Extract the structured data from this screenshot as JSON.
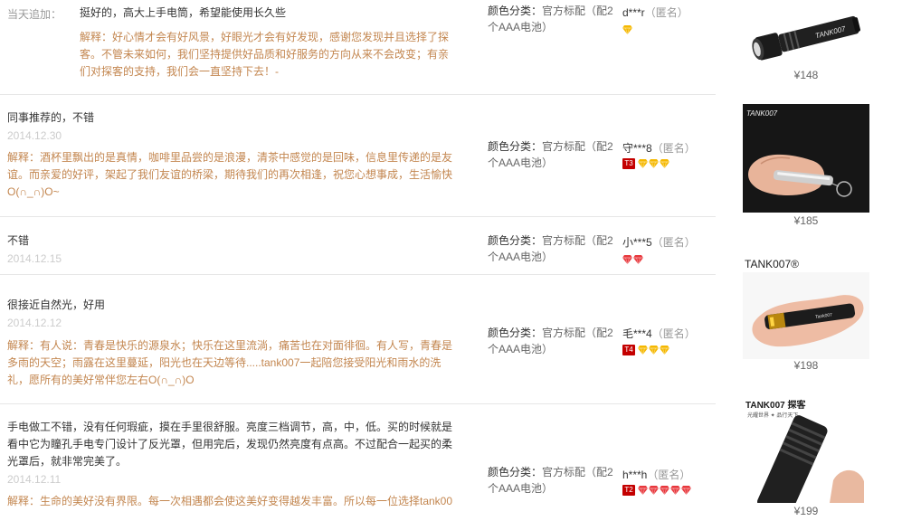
{
  "reviews": [
    {
      "append_label": "当天追加：",
      "comment": "挺好的，高大上手电筒，希望能使用长久些",
      "date": "",
      "reply": "解释：好心情才会有好风景，好眼光才会有好发现，感谢您发现并且选择了探客。不管未来如何，我们坚持提供好品质和好服务的方向从来不会改变；有亲们对探客的支持，我们会一直坚持下去！-",
      "sku_key": "颜色分类：",
      "sku_value": "官方标配（配2个AAA电池）",
      "user": "d***r",
      "anon": "（匿名）",
      "level": "",
      "gems": 1,
      "gem_color": "#f5b800"
    },
    {
      "comment": "同事推荐的，不错",
      "date": "2014.12.30",
      "reply": "解释：酒杯里飘出的是真情，咖啡里品尝的是浪漫，清茶中感觉的是回味，信息里传递的是友谊。而亲爱的好评，架起了我们友谊的桥梁，期待我们的再次相逢，祝您心想事成，生活愉快O(∩_∩)O~",
      "sku_key": "颜色分类：",
      "sku_value": "官方标配（配2个AAA电池）",
      "user": "守***8",
      "anon": "（匿名）",
      "level": "T3",
      "gems": 3,
      "gem_color": "#f5b800"
    },
    {
      "comment": "不错",
      "date": "2014.12.15",
      "reply": "",
      "sku_key": "颜色分类：",
      "sku_value": "官方标配（配2个AAA电池）",
      "user": "小***5",
      "anon": "（匿名）",
      "level": "",
      "gems": 2,
      "gem_color": "#e8383d"
    },
    {
      "comment": "很接近自然光，好用",
      "date": "2014.12.12",
      "reply": "解释：有人说：青春是快乐的源泉水；快乐在这里流淌，痛苦也在对面徘徊。有人写，青春是多雨的天空；雨露在这里蔓延，阳光也在天边等待.....tank007一起陪您接受阳光和雨水的洗礼，愿所有的美好常伴您左右O(∩_∩)O",
      "sku_key": "颜色分类：",
      "sku_value": "官方标配（配2个AAA电池）",
      "user": "毛***4",
      "anon": "（匿名）",
      "level": "T4",
      "gems": 3,
      "gem_color": "#f5b800"
    },
    {
      "comment": "手电做工不错，没有任何瑕疵，摸在手里很舒服。亮度三档调节，高，中，低。买的时候就是看中它为瞳孔手电专门设计了反光罩，但用完后，发现仍然亮度有点高。不过配合一起买的柔光罩后，就非常完美了。",
      "date": "2014.12.11",
      "reply": "解释：生命的美好没有界限。每一次相遇都会使这美好变得越发丰富。所以每一位选择tank00",
      "sku_key": "颜色分类：",
      "sku_value": "官方标配（配2个AAA电池）",
      "user": "h***h",
      "anon": "（匿名）",
      "level": "T2",
      "gems": 5,
      "gem_color": "#e8383d"
    }
  ],
  "products": [
    {
      "price": "¥148",
      "image": "flashlight-black",
      "brand": "TANK007"
    },
    {
      "price": "¥185",
      "image": "flashlight-silver-in-hand",
      "brand": "TANK007"
    },
    {
      "price": "¥198",
      "image": "flashlight-uv-in-hand",
      "brand": "TANK007®"
    },
    {
      "price": "¥199",
      "image": "flashlight-black-zoom",
      "brand": "TANK007 探客",
      "slogan": "光耀世界 ✦ 品行天下"
    }
  ]
}
